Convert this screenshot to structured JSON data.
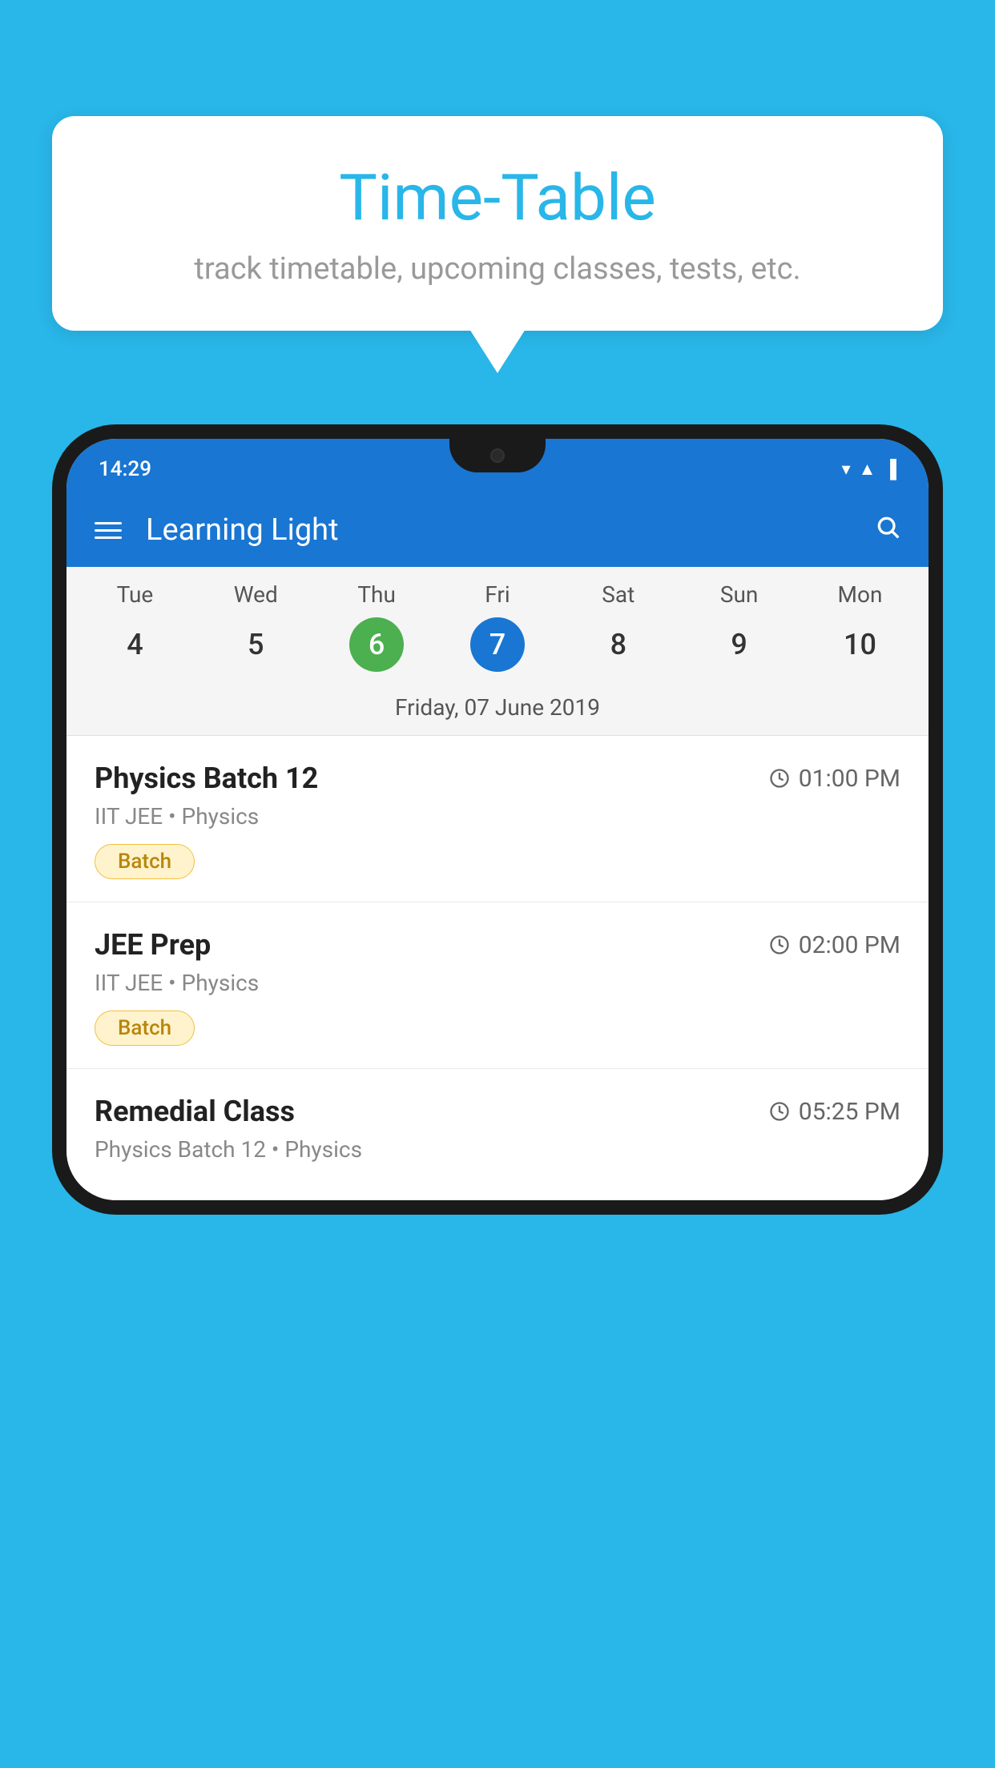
{
  "background_color": "#29b6e8",
  "speech_bubble": {
    "title": "Time-Table",
    "subtitle": "track timetable, upcoming classes, tests, etc."
  },
  "app": {
    "name": "Learning Light",
    "status_bar": {
      "time": "14:29",
      "icons": [
        "wifi",
        "signal",
        "battery"
      ]
    }
  },
  "calendar": {
    "selected_date_label": "Friday, 07 June 2019",
    "days": [
      {
        "name": "Tue",
        "num": "4",
        "state": "normal"
      },
      {
        "name": "Wed",
        "num": "5",
        "state": "normal"
      },
      {
        "name": "Thu",
        "num": "6",
        "state": "today"
      },
      {
        "name": "Fri",
        "num": "7",
        "state": "selected"
      },
      {
        "name": "Sat",
        "num": "8",
        "state": "normal"
      },
      {
        "name": "Sun",
        "num": "9",
        "state": "normal"
      },
      {
        "name": "Mon",
        "num": "10",
        "state": "normal"
      }
    ]
  },
  "schedule": [
    {
      "title": "Physics Batch 12",
      "time": "01:00 PM",
      "subtitle": "IIT JEE • Physics",
      "badge": "Batch"
    },
    {
      "title": "JEE Prep",
      "time": "02:00 PM",
      "subtitle": "IIT JEE • Physics",
      "badge": "Batch"
    },
    {
      "title": "Remedial Class",
      "time": "05:25 PM",
      "subtitle": "Physics Batch 12 • Physics",
      "badge": null
    }
  ],
  "toolbar": {
    "menu_label": "menu",
    "search_label": "search"
  },
  "badges": {
    "batch_label": "Batch"
  }
}
